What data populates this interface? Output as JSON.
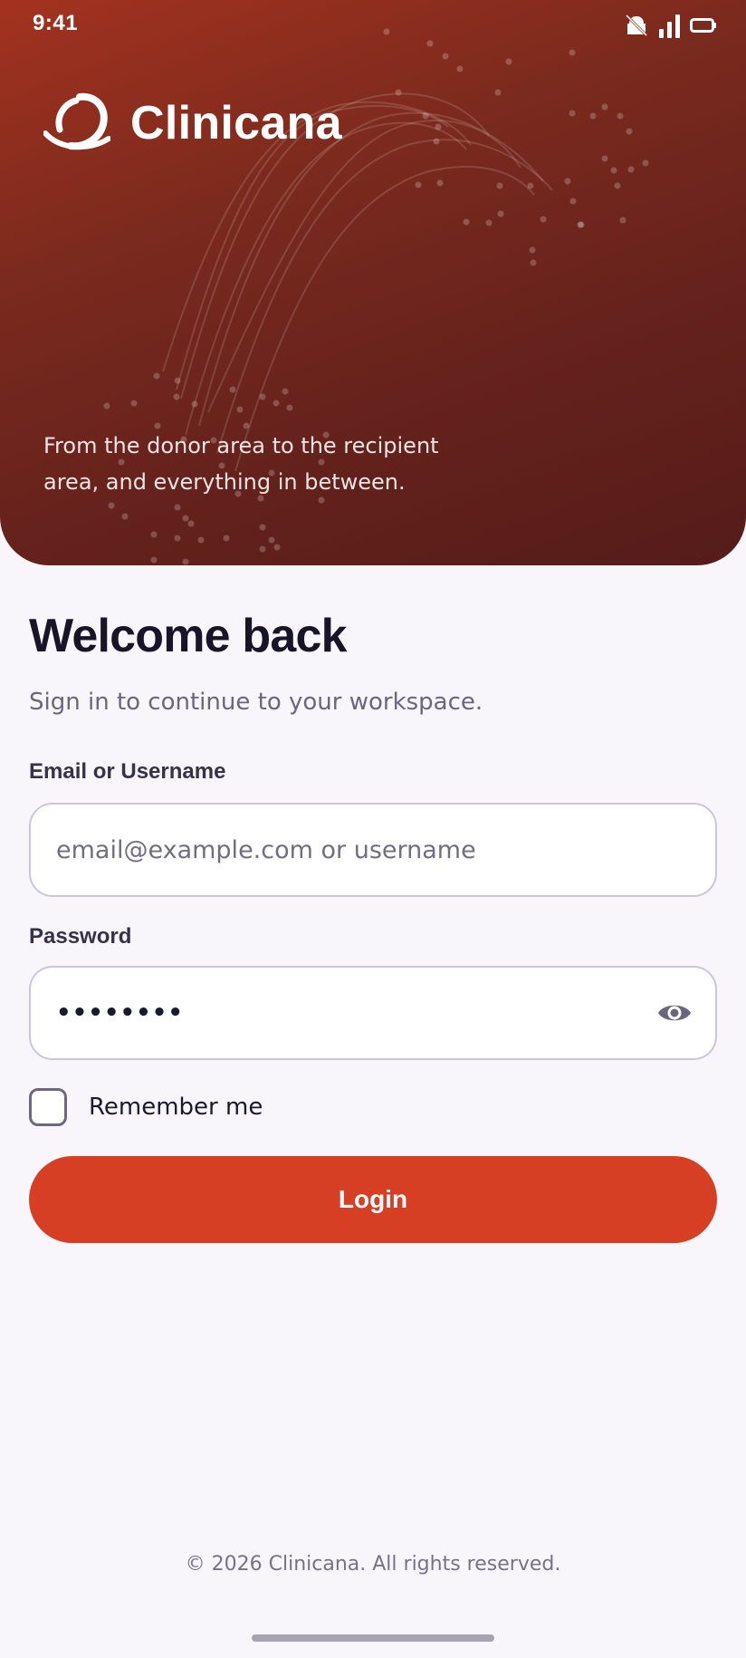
{
  "status_bar": {
    "time": "9:41",
    "icons": [
      "notification-off-icon",
      "signal-icon",
      "battery-icon"
    ]
  },
  "hero": {
    "brand_name": "Clinicana",
    "logo_icon": "clinicana-logo",
    "tagline": "From the donor area to the recipient area, and everything in between.",
    "gradient_colors": [
      "#a3321f",
      "#66221c",
      "#551c19"
    ]
  },
  "login_form": {
    "title": "Welcome back",
    "subtitle": "Sign in to continue to your workspace.",
    "email_label": "Email or Username",
    "email_placeholder": "email@example.com or username",
    "email_value": "",
    "password_label": "Password",
    "password_value": "password",
    "password_toggle_icon": "eye-icon",
    "remember_label": "Remember me",
    "remember_checked": false,
    "login_label": "Login"
  },
  "footer": {
    "copyright": "© 2026 Clinicana. All rights reserved."
  },
  "colors": {
    "accent": "#d63f24",
    "background": "#f8f6fb",
    "title": "#171527",
    "muted_text": "#6b6680",
    "input_border": "#cbc6dd"
  }
}
